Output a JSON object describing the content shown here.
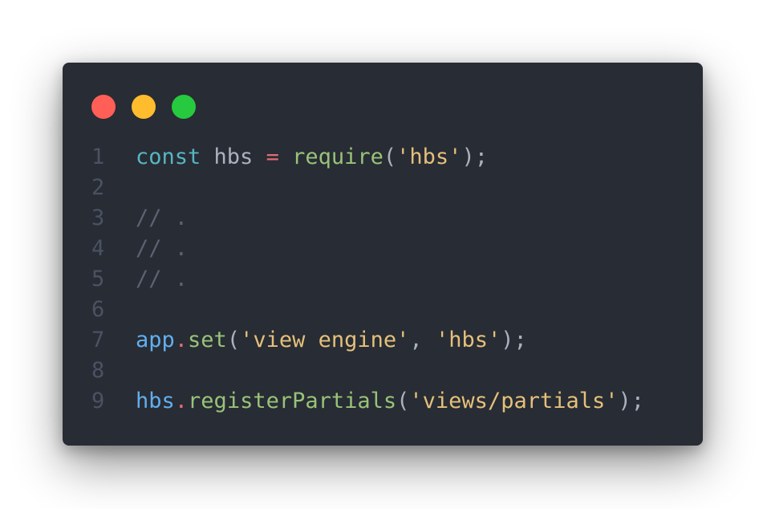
{
  "window": {
    "dots": [
      {
        "name": "close",
        "color": "#ff5f56"
      },
      {
        "name": "minimize",
        "color": "#ffbd2e"
      },
      {
        "name": "maximize",
        "color": "#27c93f"
      }
    ]
  },
  "colors": {
    "background": "#282c34",
    "line_number": "#4b5263",
    "keyword": "#56b6c2",
    "plain": "#abb2bf",
    "operator": "#e06c75",
    "function": "#98c379",
    "string": "#e5c07b",
    "comment": "#5c6370",
    "object": "#61afef"
  },
  "code": {
    "lines": [
      {
        "number": "1",
        "tokens": [
          {
            "text": "const",
            "type": "kw"
          },
          {
            "text": " hbs ",
            "type": "plain"
          },
          {
            "text": "=",
            "type": "op"
          },
          {
            "text": " ",
            "type": "plain"
          },
          {
            "text": "require",
            "type": "fn"
          },
          {
            "text": "(",
            "type": "plain"
          },
          {
            "text": "'hbs'",
            "type": "str"
          },
          {
            "text": ");",
            "type": "plain"
          }
        ]
      },
      {
        "number": "2",
        "tokens": []
      },
      {
        "number": "3",
        "tokens": [
          {
            "text": "// .",
            "type": "cmt"
          }
        ]
      },
      {
        "number": "4",
        "tokens": [
          {
            "text": "// .",
            "type": "cmt"
          }
        ]
      },
      {
        "number": "5",
        "tokens": [
          {
            "text": "// .",
            "type": "cmt"
          }
        ]
      },
      {
        "number": "6",
        "tokens": []
      },
      {
        "number": "7",
        "tokens": [
          {
            "text": "app",
            "type": "obj"
          },
          {
            "text": ".",
            "type": "op"
          },
          {
            "text": "set",
            "type": "fn"
          },
          {
            "text": "(",
            "type": "plain"
          },
          {
            "text": "'view engine'",
            "type": "str"
          },
          {
            "text": ", ",
            "type": "plain"
          },
          {
            "text": "'hbs'",
            "type": "str"
          },
          {
            "text": ");",
            "type": "plain"
          }
        ]
      },
      {
        "number": "8",
        "tokens": []
      },
      {
        "number": "9",
        "tokens": [
          {
            "text": "hbs",
            "type": "obj"
          },
          {
            "text": ".",
            "type": "op"
          },
          {
            "text": "registerPartials",
            "type": "fn"
          },
          {
            "text": "(",
            "type": "plain"
          },
          {
            "text": "'views/partials'",
            "type": "str"
          },
          {
            "text": ");",
            "type": "plain"
          }
        ]
      }
    ]
  }
}
